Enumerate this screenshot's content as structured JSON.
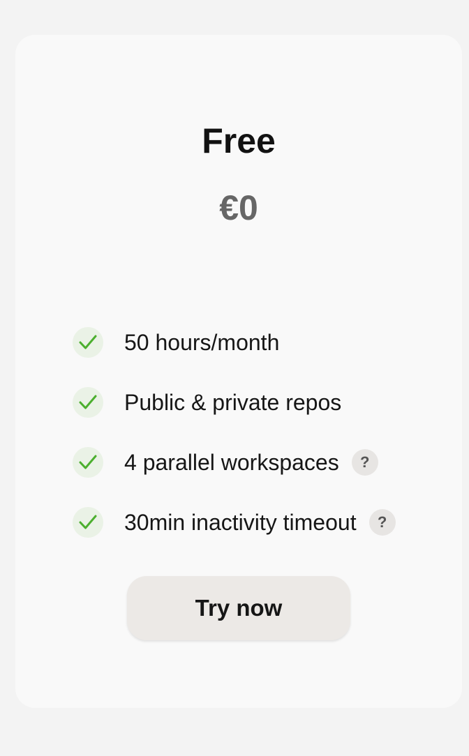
{
  "plan": {
    "name": "Free",
    "price": "€0"
  },
  "features": [
    {
      "label": "50 hours/month",
      "has_help": false
    },
    {
      "label": "Public & private repos",
      "has_help": false
    },
    {
      "label": "4 parallel workspaces",
      "has_help": true
    },
    {
      "label": "30min inactivity timeout",
      "has_help": true
    }
  ],
  "help_glyph": "?",
  "cta": {
    "label": "Try now"
  },
  "colors": {
    "check_green": "#4caf2f",
    "check_bg": "#eaf2e6",
    "price_gray": "#666666",
    "button_bg": "#ece9e6"
  },
  "icons": {
    "feature_check": "check-icon",
    "feature_help": "question-mark-icon"
  }
}
